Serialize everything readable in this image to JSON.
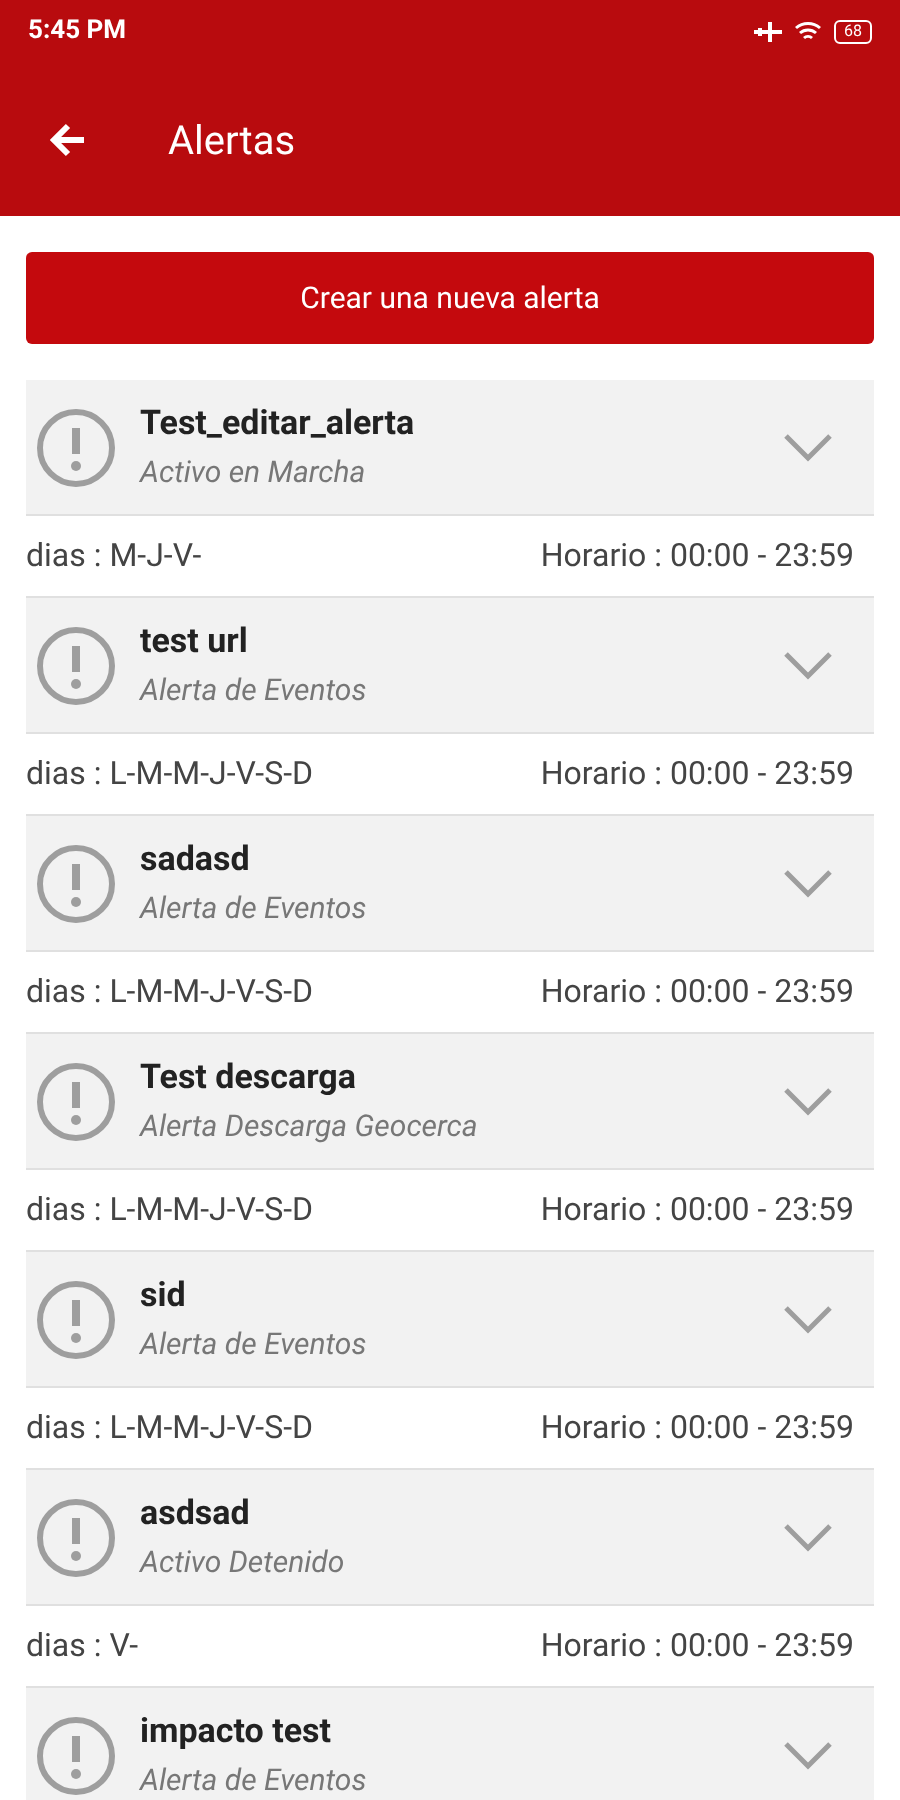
{
  "status_bar": {
    "time": "5:45 PM",
    "battery": "68"
  },
  "app_bar": {
    "title": "Alertas"
  },
  "create_button": "Crear una nueva alerta",
  "alerts": [
    {
      "name": "Test_editar_alerta",
      "type": "Activo en Marcha",
      "days": "dias : M-J-V-",
      "schedule": "Horario : 00:00 - 23:59"
    },
    {
      "name": "test url",
      "type": "Alerta de Eventos",
      "days": "dias : L-M-M-J-V-S-D",
      "schedule": "Horario : 00:00 - 23:59"
    },
    {
      "name": "sadasd",
      "type": "Alerta de Eventos",
      "days": "dias : L-M-M-J-V-S-D",
      "schedule": "Horario : 00:00 - 23:59"
    },
    {
      "name": "Test descarga",
      "type": "Alerta Descarga Geocerca",
      "days": "dias : L-M-M-J-V-S-D",
      "schedule": "Horario : 00:00 - 23:59"
    },
    {
      "name": "sid",
      "type": "Alerta de Eventos",
      "days": "dias : L-M-M-J-V-S-D",
      "schedule": "Horario : 00:00 - 23:59"
    },
    {
      "name": "asdsad",
      "type": "Activo Detenido",
      "days": "dias : V-",
      "schedule": "Horario : 00:00 - 23:59"
    },
    {
      "name": "impacto test",
      "type": "Alerta de Eventos"
    }
  ]
}
